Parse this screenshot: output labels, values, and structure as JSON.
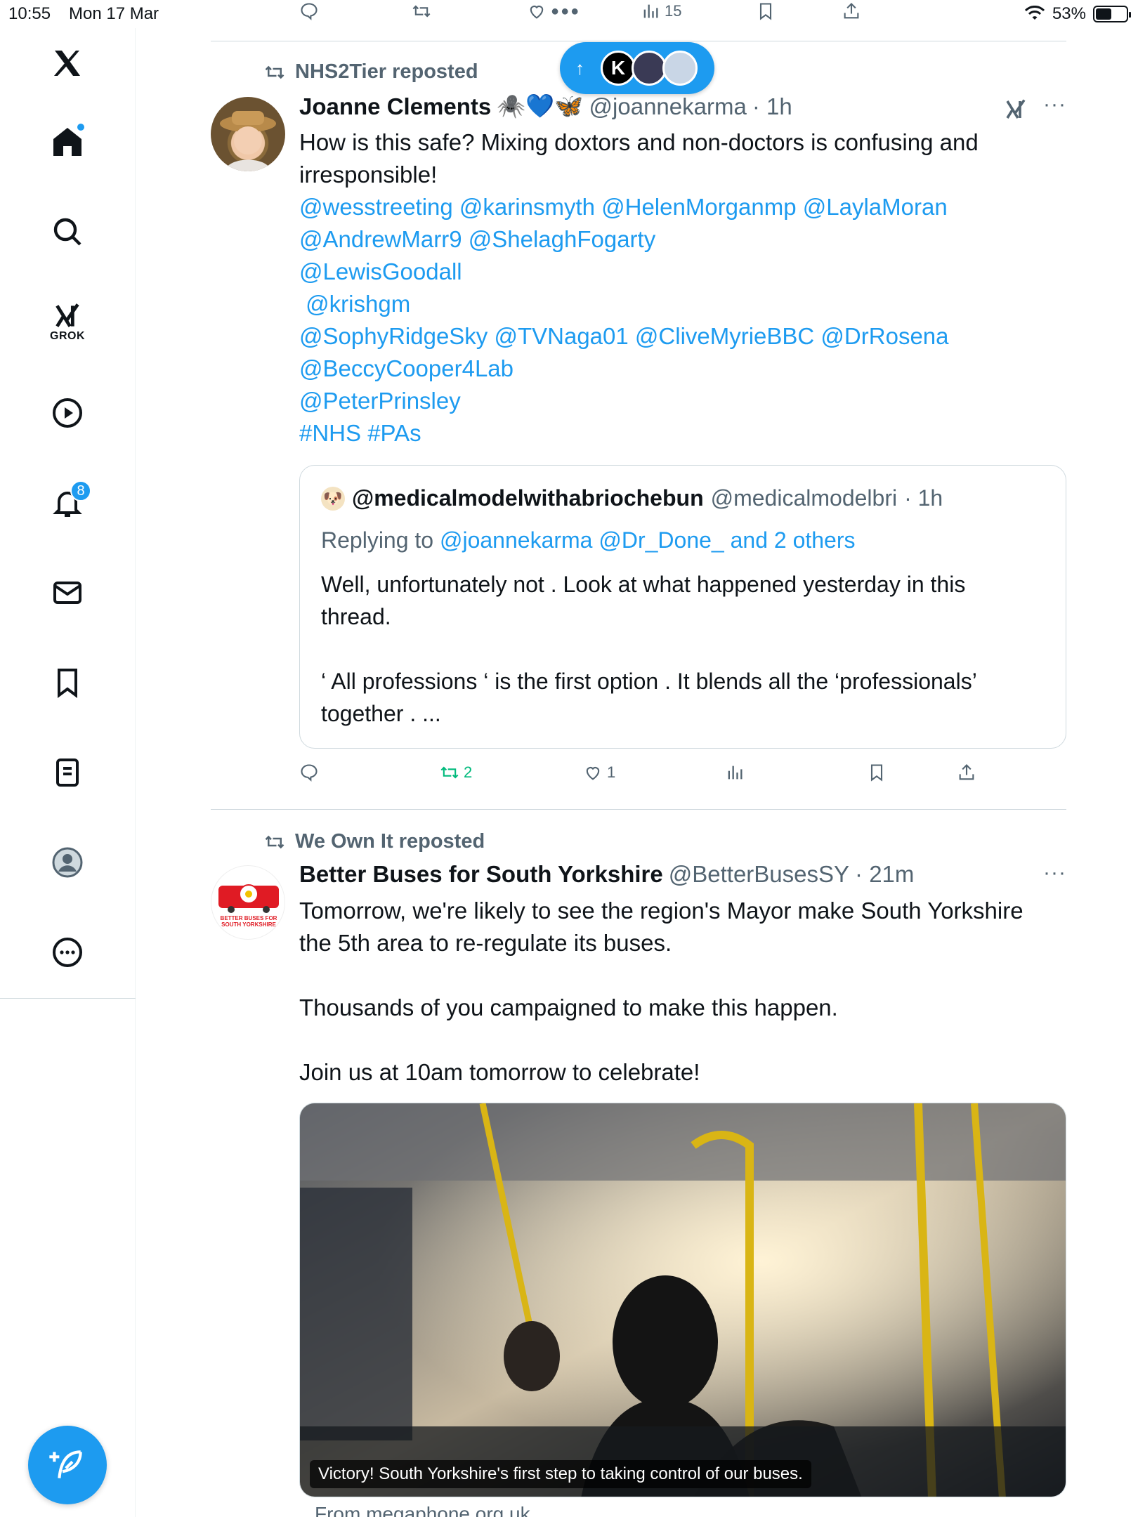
{
  "status_bar": {
    "time": "10:55",
    "date": "Mon 17 Mar",
    "battery": "53%",
    "battery_level": 0.53
  },
  "sidebar": {
    "items": [
      {
        "name": "home",
        "label": ""
      },
      {
        "name": "explore",
        "label": ""
      },
      {
        "name": "grok",
        "label": "GROK"
      },
      {
        "name": "video",
        "label": ""
      },
      {
        "name": "notifications",
        "label": "",
        "badge": "8"
      },
      {
        "name": "messages",
        "label": ""
      },
      {
        "name": "bookmarks",
        "label": ""
      },
      {
        "name": "lists",
        "label": ""
      },
      {
        "name": "profile",
        "label": ""
      },
      {
        "name": "more",
        "label": ""
      }
    ]
  },
  "previous_post_actions": {
    "views": "15"
  },
  "new_posts_pill": {
    "avatar_letter": "K"
  },
  "posts": [
    {
      "reposted_by": "NHS2Tier reposted",
      "name": "Joanne Clements",
      "emoji": "🕷️💙🦋",
      "handle": "@joannekarma",
      "time": "· 1h",
      "text_lines": [
        "How is this safe? Mixing doxtors and non-doctors is confusing and",
        "irresponsible!"
      ],
      "link_lines": [
        "@wesstreeting @karinsmyth @HelenMorganmp @LaylaMoran",
        "@AndrewMarr9 @ShelaghFogarty",
        "@LewisGoodall",
        " @krishgm",
        "@SophyRidgeSky @TVNaga01 @CliveMyrieBBC @DrRosena",
        "@BeccyCooper4Lab",
        "@PeterPrinsley",
        "#NHS #PAs"
      ],
      "quote": {
        "name": "@medicalmodelwithabriochebun",
        "handle": "@medicalmodelbri",
        "time": "· 1h",
        "replying_prefix": "Replying to ",
        "replying_to": "@joannekarma @Dr_Done_ and 2 others",
        "text": "Well, unfortunately not . Look at what happened yesterday in this\nthread.\n\n‘ All professions ‘ is the first option . It blends all the ‘professionals’\ntogether . ..."
      },
      "actions": {
        "reposts": "2",
        "likes": "1",
        "views": ""
      }
    },
    {
      "reposted_by": "We Own It reposted",
      "name": "Better Buses for South Yorkshire",
      "handle": "@BetterBusesSY",
      "time": "· 21m",
      "avatar_text": "BETTER BUSES FOR SOUTH YORKSHIRE",
      "text": "Tomorrow, we're likely to see the region's Mayor make South Yorkshire\nthe 5th area to re-regulate its buses.\n\nThousands of you campaigned to make this happen.\n\nJoin us at 10am tomorrow to celebrate!",
      "media_caption": "Victory! South Yorkshire's first step to taking control of our buses.",
      "source": "From megaphone.org.uk"
    }
  ],
  "colors": {
    "accent": "#1d9bf0",
    "repost_green": "#00ba7c",
    "muted": "#536471"
  }
}
